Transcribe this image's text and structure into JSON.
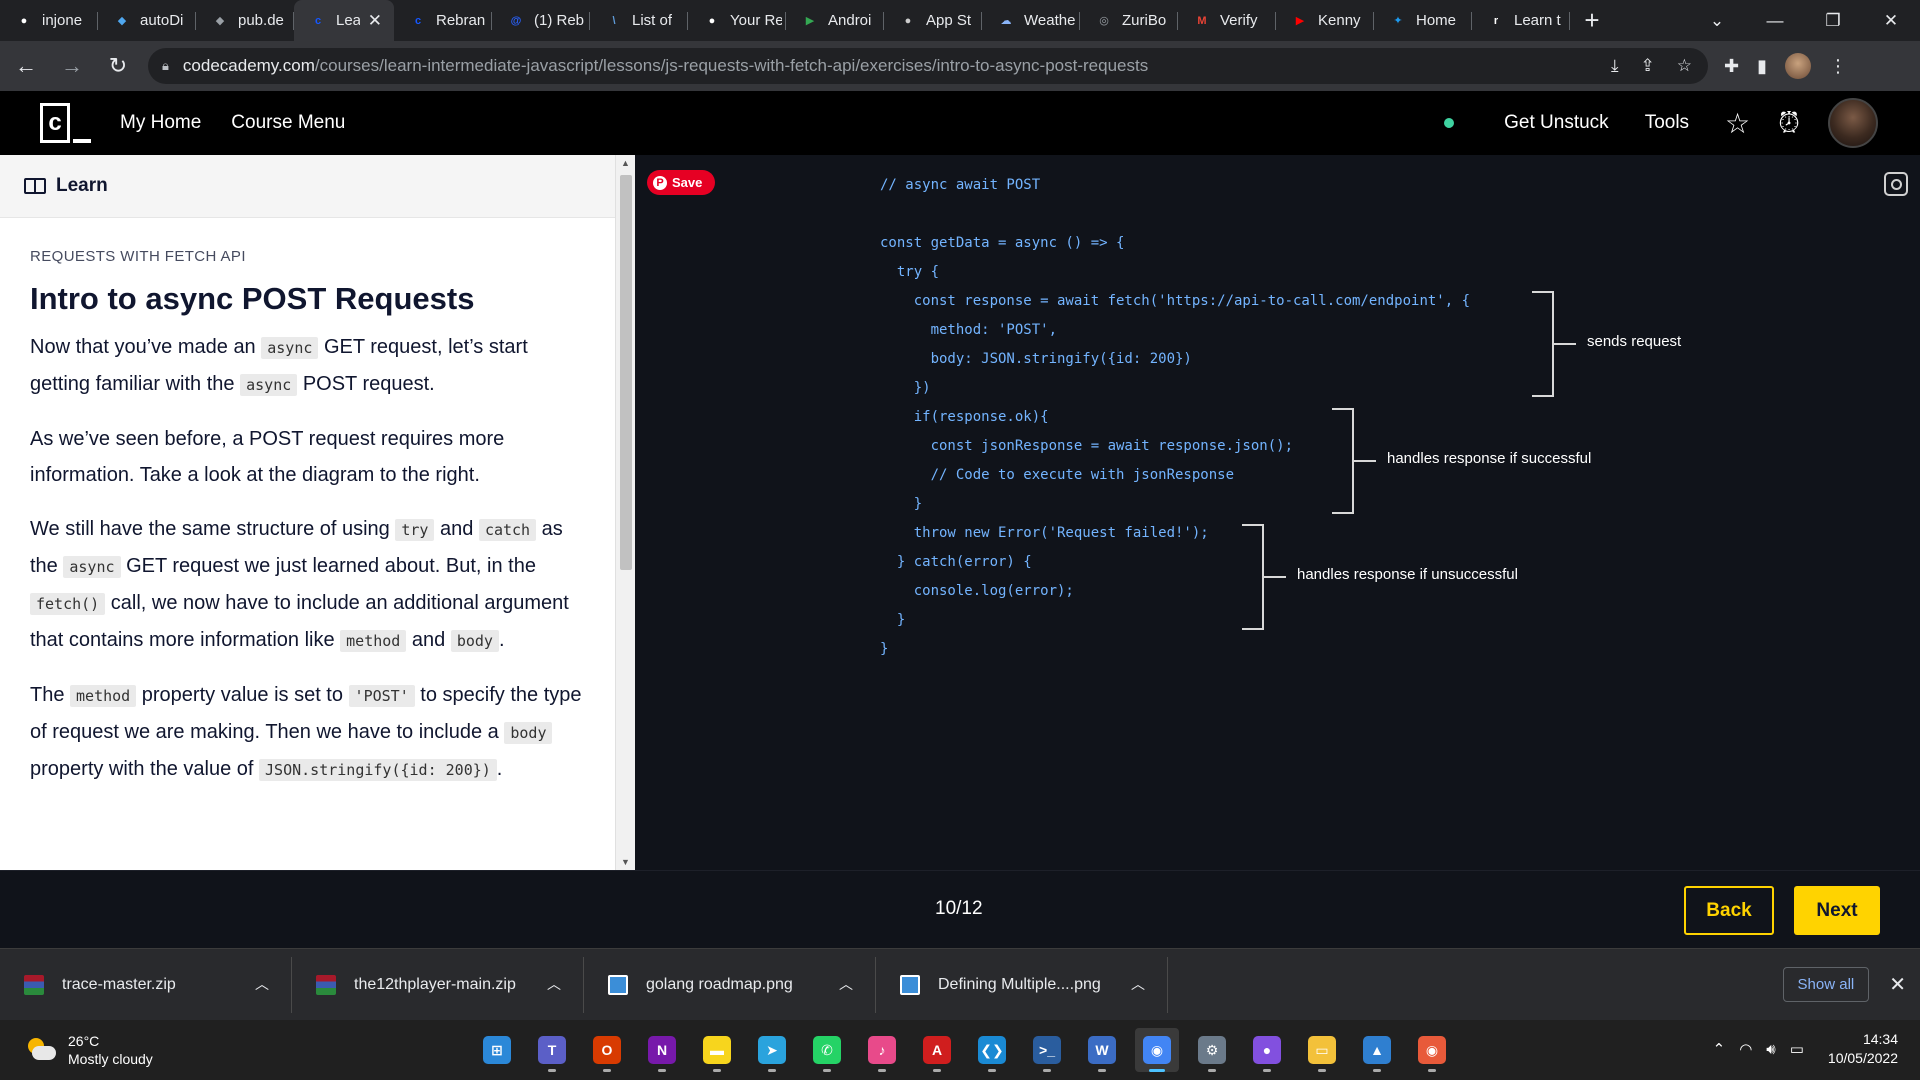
{
  "browser": {
    "tabs": [
      {
        "title": "injone",
        "icon": "github-icon",
        "color": "#ffffff",
        "glyph": "●"
      },
      {
        "title": "autoDi",
        "icon": "flutter-icon",
        "color": "#4fa7ef",
        "glyph": "◆"
      },
      {
        "title": "pub.de",
        "icon": "dart-icon",
        "color": "#9aa0a6",
        "glyph": "◆"
      },
      {
        "title": "Lea",
        "icon": "codecademy-icon",
        "color": "#1557ff",
        "glyph": "c",
        "active": true
      },
      {
        "title": "Rebran",
        "icon": "codecademy-icon",
        "color": "#1557ff",
        "glyph": "c"
      },
      {
        "title": "(1) Reb",
        "icon": "hashnode-icon",
        "color": "#2962ff",
        "glyph": "@"
      },
      {
        "title": "List of",
        "icon": "library-icon",
        "color": "#5f9bd8",
        "glyph": "\\"
      },
      {
        "title": "Your Re",
        "icon": "github-icon",
        "color": "#ffffff",
        "glyph": "●"
      },
      {
        "title": "Androi",
        "icon": "play-store-icon",
        "color": "#34a853",
        "glyph": "▶"
      },
      {
        "title": "App St",
        "icon": "apple-icon",
        "color": "#cccccc",
        "glyph": "●"
      },
      {
        "title": "Weathe",
        "icon": "weather-icon",
        "color": "#8ab4f8",
        "glyph": "☁"
      },
      {
        "title": "ZuriBo",
        "icon": "globe-icon",
        "color": "#9aa0a6",
        "glyph": "◎"
      },
      {
        "title": "Verify",
        "icon": "gmail-icon",
        "color": "#ea4335",
        "glyph": "M"
      },
      {
        "title": "Kenny",
        "icon": "youtube-icon",
        "color": "#ff0000",
        "glyph": "▶"
      },
      {
        "title": "Home",
        "icon": "twitter-icon",
        "color": "#1d9bf0",
        "glyph": "✦"
      },
      {
        "title": "Learn t",
        "icon": "codecademy-icon",
        "color": "#ffffff",
        "glyph": "r"
      }
    ],
    "active_tab_close": "✕",
    "new_tab": "+",
    "window_controls": {
      "dropdown": "⌄",
      "minimize": "—",
      "restore": "❐",
      "close": "✕"
    },
    "url_host": "codecademy.com",
    "url_path": "/courses/learn-intermediate-javascript/lessons/js-requests-with-fetch-api/exercises/intro-to-async-post-requests"
  },
  "header": {
    "logo_letter": "c",
    "nav": [
      "My Home",
      "Course Menu"
    ],
    "get_unstuck": "Get Unstuck",
    "tools": "Tools",
    "status_color": "#3fd3a1"
  },
  "learn": {
    "tab_label": "Learn",
    "eyebrow": "REQUESTS WITH FETCH API",
    "title": "Intro to async POST Requests",
    "p1": {
      "a": "Now that you’ve made an ",
      "b": "async",
      "c": " GET request, let’s start getting familiar with the ",
      "d": "async",
      "e": " POST request."
    },
    "p2": "As we’ve seen before, a POST request requires more information. Take a look at the diagram to the right.",
    "p3": {
      "a": "We still have the same structure of using ",
      "b": "try",
      "c": " and ",
      "d": "catch",
      "e": " as the ",
      "f": "async",
      "g": " GET request we just learned about. But, in the ",
      "h": "fetch()",
      "i": " call, we now have to include an additional argument that contains more information like ",
      "j": "method",
      "k": " and ",
      "l": "body",
      "m": "."
    },
    "p4": {
      "a": "The ",
      "b": "method",
      "c": " property value is set to ",
      "d": "'POST'",
      "e": " to specify the type of request we are making. Then we have to include a ",
      "f": "body",
      "g": " property with the value of ",
      "h": "JSON.stringify({id: 200})",
      "i": "."
    }
  },
  "diagram": {
    "pin_label": "Save",
    "code_lines": [
      "// async await POST",
      "const getData = async () => {",
      "  try {",
      "    const response = await fetch('https://api-to-call.com/endpoint', {",
      "      method: 'POST',",
      "      body: JSON.stringify({id: 200})",
      "    })",
      "    if(response.ok){",
      "      const jsonResponse = await response.json();",
      "      // Code to execute with jsonResponse",
      "    }",
      "    throw new Error('Request failed!');",
      "  } catch(error) {",
      "    console.log(error);",
      "  }",
      "}"
    ],
    "annotations": [
      "sends request",
      "handles response if successful",
      "handles response if unsuccessful"
    ],
    "code_color": "#73b4ff"
  },
  "lesson_nav": {
    "progress": "10/12",
    "back": "Back",
    "next": "Next",
    "accent": "#ffd300"
  },
  "downloads": {
    "items": [
      {
        "name": "trace-master.zip",
        "type": "zip"
      },
      {
        "name": "the12thplayer-main.zip",
        "type": "zip"
      },
      {
        "name": "golang roadmap.png",
        "type": "png"
      },
      {
        "name": "Defining Multiple....png",
        "type": "png"
      }
    ],
    "show_all": "Show all"
  },
  "taskbar": {
    "temperature": "26°C",
    "condition": "Mostly cloudy",
    "apps": [
      {
        "name": "start",
        "color": "#2b88d8",
        "glyph": "⊞"
      },
      {
        "name": "teams",
        "color": "#5b5fc7",
        "glyph": "T"
      },
      {
        "name": "office",
        "color": "#d83b01",
        "glyph": "O"
      },
      {
        "name": "onenote",
        "color": "#7719aa",
        "glyph": "N"
      },
      {
        "name": "sticky-notes",
        "color": "#f7d51d",
        "glyph": "▬"
      },
      {
        "name": "telegram",
        "color": "#2aa3dd",
        "glyph": "➤"
      },
      {
        "name": "whatsapp",
        "color": "#25d366",
        "glyph": "✆"
      },
      {
        "name": "itunes",
        "color": "#e84a8a",
        "glyph": "♪"
      },
      {
        "name": "acrobat",
        "color": "#d01e1e",
        "glyph": "A"
      },
      {
        "name": "vscode",
        "color": "#1a8ad4",
        "glyph": "❮❯"
      },
      {
        "name": "powershell",
        "color": "#2a5d9e",
        "glyph": ">_"
      },
      {
        "name": "wordpad",
        "color": "#3b6cc4",
        "glyph": "W"
      },
      {
        "name": "chrome",
        "color": "#4285f4",
        "glyph": "◉",
        "active": true
      },
      {
        "name": "settings",
        "color": "#6b7a8a",
        "glyph": "⚙"
      },
      {
        "name": "github-desktop",
        "color": "#8250df",
        "glyph": "●"
      },
      {
        "name": "file-explorer",
        "color": "#f3c13a",
        "glyph": "▭"
      },
      {
        "name": "photos",
        "color": "#2f7fd0",
        "glyph": "▲"
      },
      {
        "name": "chrome-beta",
        "color": "#e85a3a",
        "glyph": "◉"
      }
    ],
    "time": "14:34",
    "date": "10/05/2022"
  }
}
